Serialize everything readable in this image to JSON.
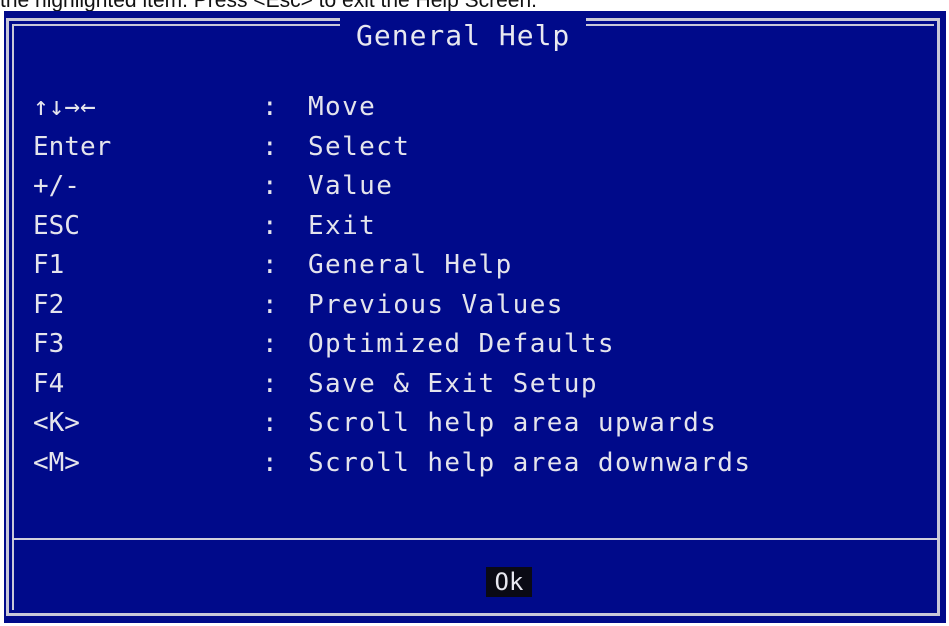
{
  "caption": "the highlighted item. Press <Esc> to exit the Help Screen.",
  "dialog": {
    "title": "General Help",
    "colors": {
      "background": "#000a8a",
      "text": "#e4e4ec",
      "frame": "#c8c8d8"
    },
    "items": [
      {
        "key": "↑↓→←",
        "sep": ":",
        "desc": "Move"
      },
      {
        "key": "Enter",
        "sep": ":",
        "desc": "Select"
      },
      {
        "key": "+/-",
        "sep": ":",
        "desc": "Value"
      },
      {
        "key": "ESC",
        "sep": ":",
        "desc": "Exit"
      },
      {
        "key": "F1",
        "sep": ":",
        "desc": "General Help"
      },
      {
        "key": "F2",
        "sep": ":",
        "desc": "Previous Values"
      },
      {
        "key": "F3",
        "sep": ":",
        "desc": "Optimized Defaults"
      },
      {
        "key": "F4",
        "sep": ":",
        "desc": "Save & Exit Setup"
      },
      {
        "key": "<K>",
        "sep": ":",
        "desc": "Scroll help area upwards"
      },
      {
        "key": "<M>",
        "sep": ":",
        "desc": "Scroll help area downwards"
      }
    ],
    "ok_label": "Ok"
  }
}
